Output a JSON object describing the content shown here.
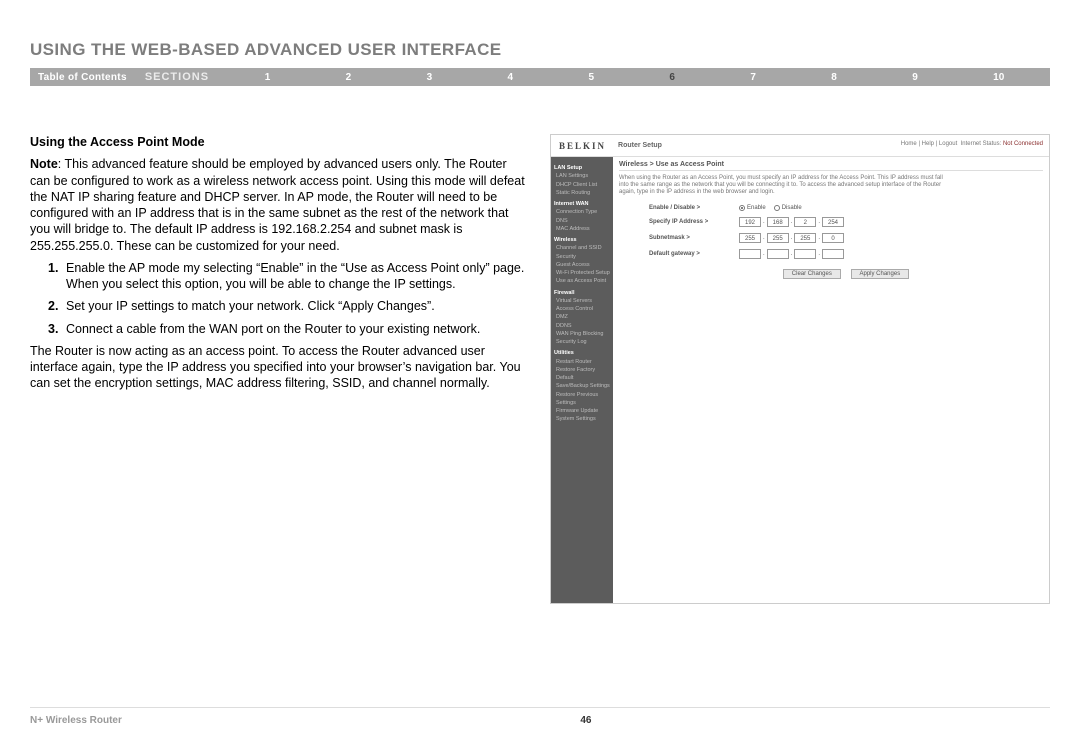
{
  "chapter_title": "USING THE WEB-BASED ADVANCED USER INTERFACE",
  "nav": {
    "toc": "Table of Contents",
    "sections": "SECTIONS",
    "numbers": [
      "1",
      "2",
      "3",
      "4",
      "5",
      "6",
      "7",
      "8",
      "9",
      "10"
    ],
    "active_index": 5
  },
  "left": {
    "subhead": "Using the Access Point Mode",
    "note_label": "Note",
    "note_body": ": This advanced feature should be employed by advanced users only. The Router can be configured to work as a wireless network access point. Using this mode will defeat the NAT IP sharing feature and DHCP server. In AP mode, the Router will need to be configured with an IP address that is in the same subnet as the rest of the network that you will bridge to. The default IP address is 192.168.2.254 and subnet mask is 255.255.255.0. These can be customized for your need.",
    "steps": [
      {
        "n": "1.",
        "t": "Enable the AP mode my selecting “Enable” in the “Use as Access Point only” page. When you select this option, you will be able to change the IP settings."
      },
      {
        "n": "2.",
        "t": "Set your IP settings to match your network. Click “Apply Changes”."
      },
      {
        "n": "3.",
        "t": "Connect a cable from the WAN port on the Router to your existing network."
      }
    ],
    "closing": "The Router is now acting as an access point. To access the Router advanced user interface again, type the IP address you specified into your browser’s navigation bar. You can set the encryption settings, MAC address filtering, SSID, and channel normally."
  },
  "router": {
    "brand": "BELKIN",
    "title": "Router Setup",
    "top_links": "Home | Help | Logout",
    "status_label": "Internet Status:",
    "status_value": "Not Connected",
    "crumb": "Wireless > Use as Access Point",
    "intro": "When using the Router as an Access Point, you must specify an IP address for the Access Point. This IP address must fall into the same range as the network that you will be connecting it to. To access the advanced setup interface of the Router again, type in the IP address in the web browser and login.",
    "sidebar": {
      "groups": [
        {
          "head": "LAN Setup",
          "items": [
            "LAN Settings",
            "DHCP Client List",
            "Static Routing"
          ]
        },
        {
          "head": "Internet WAN",
          "items": [
            "Connection Type",
            "DNS",
            "MAC Address"
          ]
        },
        {
          "head": "Wireless",
          "items": [
            "Channel and SSID",
            "Security",
            "Guest Access",
            "Wi-Fi Protected Setup",
            "Use as Access Point"
          ]
        },
        {
          "head": "Firewall",
          "items": [
            "Virtual Servers",
            "Access Control",
            "DMZ",
            "DDNS",
            "WAN Ping Blocking",
            "Security Log"
          ]
        },
        {
          "head": "Utilities",
          "items": [
            "Restart Router",
            "Restore Factory Default",
            "Save/Backup Settings",
            "Restore Previous Settings",
            "Firmware Update",
            "System Settings"
          ]
        }
      ]
    },
    "form": {
      "enable_label": "Enable / Disable >",
      "enable_opt": "Enable",
      "disable_opt": "Disable",
      "ip_label": "Specify IP Address >",
      "ip_values": [
        "192",
        "168",
        "2",
        "254"
      ],
      "subnet_label": "Subnetmask >",
      "subnet_values": [
        "255",
        "255",
        "255",
        "0"
      ],
      "gateway_label": "Default gateway >",
      "gateway_values": [
        "",
        "",
        "",
        ""
      ],
      "btn_clear": "Clear Changes",
      "btn_apply": "Apply Changes"
    }
  },
  "footer": {
    "product": "N+ Wireless Router",
    "page": "46"
  }
}
